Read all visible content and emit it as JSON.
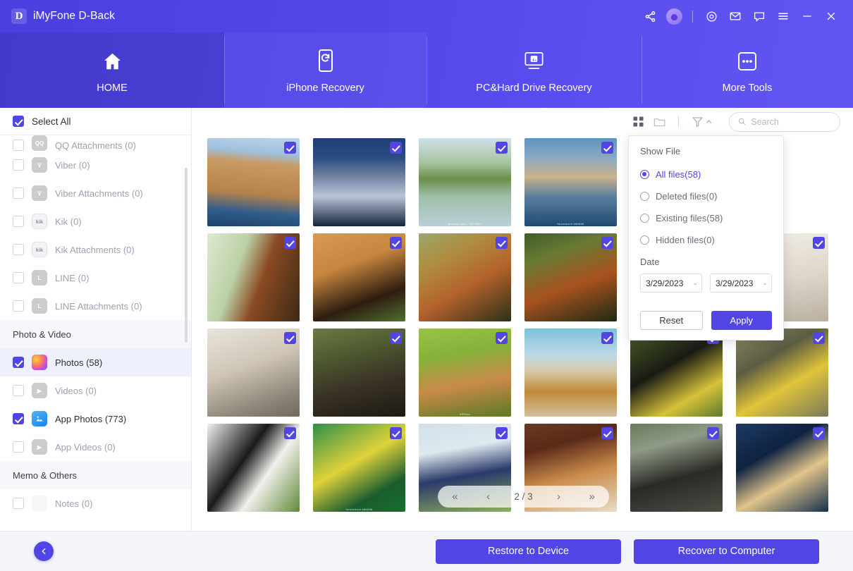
{
  "window": {
    "logo_letter": "D",
    "app_title": "iMyFone D-Back",
    "titlebar_icons": [
      {
        "name": "share-icon"
      },
      {
        "name": "account-avatar-icon"
      },
      {
        "name": "target-icon"
      },
      {
        "name": "mail-icon"
      },
      {
        "name": "chat-icon"
      },
      {
        "name": "menu-icon"
      },
      {
        "name": "minimize-icon"
      },
      {
        "name": "close-icon"
      }
    ]
  },
  "nav": {
    "tabs": [
      {
        "id": "home",
        "label": "HOME",
        "icon": "house-icon",
        "active": true
      },
      {
        "id": "iphone",
        "label": "iPhone Recovery",
        "icon": "phone-refresh-icon",
        "active": false
      },
      {
        "id": "pc",
        "label": "PC&Hard Drive Recovery",
        "icon": "monitor-key-icon",
        "active": false
      },
      {
        "id": "more",
        "label": "More Tools",
        "icon": "ellipsis-box-icon",
        "active": false
      }
    ]
  },
  "sidebar": {
    "select_all_label": "Select All",
    "select_all_checked": true,
    "items": [
      {
        "label": "QQ Attachments (0)",
        "icon": "qq-icon",
        "checked": false,
        "enabled": false,
        "clipped": true
      },
      {
        "label": "Viber (0)",
        "icon": "viber-icon",
        "checked": false,
        "enabled": false
      },
      {
        "label": "Viber Attachments (0)",
        "icon": "viber-icon",
        "checked": false,
        "enabled": false
      },
      {
        "label": "Kik (0)",
        "icon": "kik-icon",
        "checked": false,
        "enabled": false
      },
      {
        "label": "Kik Attachments (0)",
        "icon": "kik-icon",
        "checked": false,
        "enabled": false
      },
      {
        "label": "LINE (0)",
        "icon": "line-icon",
        "checked": false,
        "enabled": false
      },
      {
        "label": "LINE Attachments (0)",
        "icon": "line-icon",
        "checked": false,
        "enabled": false
      }
    ],
    "section_photo_video": "Photo & Video",
    "media_items": [
      {
        "label": "Photos (58)",
        "icon": "photos-icon",
        "checked": true,
        "enabled": true,
        "active": true
      },
      {
        "label": "Videos (0)",
        "icon": "videos-icon",
        "checked": false,
        "enabled": false
      },
      {
        "label": "App Photos (773)",
        "icon": "app-photos-icon",
        "checked": true,
        "enabled": true
      },
      {
        "label": "App Videos (0)",
        "icon": "app-videos-icon",
        "checked": false,
        "enabled": false
      }
    ],
    "section_memo_others": "Memo & Others",
    "other_items": [
      {
        "label": "Notes (0)",
        "icon": "notes-icon",
        "checked": false,
        "enabled": false
      }
    ]
  },
  "toolbar": {
    "grid_view_icon": "grid-view-icon",
    "folder_view_icon": "folder-view-icon",
    "filter_icon": "filter-icon",
    "filter_caret": "chevron-up-icon",
    "search_icon": "search-icon",
    "search_value": "",
    "search_placeholder": "Search"
  },
  "filter_panel": {
    "title": "Show File",
    "options": [
      {
        "label": "All files(58)",
        "selected": true
      },
      {
        "label": "Deleted files(0)",
        "selected": false
      },
      {
        "label": "Existing files(58)",
        "selected": false
      },
      {
        "label": "Hidden files(0)",
        "selected": false
      }
    ],
    "date_label": "Date",
    "date_from": "3/29/2023",
    "date_to": "3/29/2023",
    "reset_label": "Reset",
    "apply_label": "Apply",
    "accent": "#5145e5"
  },
  "pager": {
    "first_label": "«",
    "prev_label": "‹",
    "page_text": "2 / 3",
    "next_label": "›",
    "last_label": "»"
  },
  "footer": {
    "back_icon": "arrow-left-icon",
    "restore_label": "Restore to Device",
    "recover_label": "Recover to Computer"
  },
  "grid": {
    "columns": 6,
    "rows": 4,
    "items": [
      {
        "alt": "coastal-village-canal",
        "checked": true,
        "caption": "",
        "c1": "#8fb4d6",
        "c2": "#c99a63",
        "c3": "#2f5d8c",
        "style": "village"
      },
      {
        "alt": "mountain-town-at-dusk",
        "checked": true,
        "caption": "",
        "c1": "#2a4c82",
        "c2": "#b9c4d8",
        "c3": "#16233e",
        "style": "town"
      },
      {
        "alt": "tree-by-river",
        "checked": true,
        "caption": "pixabay.com - 3571803",
        "c1": "#b9cfd8",
        "c2": "#6a8f4a",
        "c3": "#d9e2e4",
        "style": "tree"
      },
      {
        "alt": "lakeside-houses",
        "checked": true,
        "caption": "fotosearch  k86666",
        "c1": "#4f86b8",
        "c2": "#c9b28a",
        "c3": "#1e4a72",
        "style": "lake"
      },
      {
        "alt": "sunrise-over-field",
        "checked": true,
        "caption": "",
        "c1": "#f0a33a",
        "c2": "#7fa23c",
        "c3": "#d97a2a",
        "style": "sunrise"
      },
      {
        "alt": "blank-white-tile",
        "checked": false,
        "caption": "",
        "c1": "#ffffff",
        "c2": "#ffffff",
        "c3": "#ffffff",
        "style": "blank"
      },
      {
        "alt": "red-panda-on-tree",
        "checked": true,
        "caption": "",
        "c1": "#dfe8d2",
        "c2": "#8a4a22",
        "c3": "#3c2a16",
        "style": "panda-tree"
      },
      {
        "alt": "red-panda-eating-bamboo",
        "checked": true,
        "caption": "",
        "c1": "#c7863f",
        "c2": "#4f7030",
        "c3": "#2e1d10",
        "style": "panda-eat"
      },
      {
        "alt": "red-panda-standing",
        "checked": true,
        "caption": "",
        "c1": "#9aa86a",
        "c2": "#b4622c",
        "c3": "#2b3018",
        "style": "panda-stand"
      },
      {
        "alt": "red-panda-on-logs",
        "checked": true,
        "caption": "",
        "c1": "#3f5c28",
        "c2": "#a8521f",
        "c3": "#1d2a12",
        "style": "panda-log"
      },
      {
        "alt": "blank-white-tile-2",
        "checked": false,
        "caption": "",
        "c1": "#ffffff",
        "c2": "#ffffff",
        "c3": "#ffffff",
        "style": "blank"
      },
      {
        "alt": "white-puppy",
        "checked": true,
        "caption": "",
        "c1": "#f2efe9",
        "c2": "#ded6c8",
        "c3": "#b9b0a2",
        "style": "puppy"
      },
      {
        "alt": "white-tiger-cubs",
        "checked": true,
        "caption": "",
        "c1": "#e8e4dc",
        "c2": "#8f8779",
        "c3": "#cfc6b6",
        "style": "tiger"
      },
      {
        "alt": "ibex-with-horns",
        "checked": true,
        "caption": "",
        "c1": "#6d7a44",
        "c2": "#3a3226",
        "c3": "#1c1a12",
        "style": "ibex"
      },
      {
        "alt": "caracal-snarling",
        "checked": true,
        "caption": "ARKive",
        "c1": "#86b23a",
        "c2": "#c98a4a",
        "c3": "#5a7a24",
        "style": "caracal"
      },
      {
        "alt": "shell-on-beach",
        "checked": true,
        "caption": "",
        "c1": "#7fc0dd",
        "c2": "#d9c9a8",
        "c3": "#c08a3a",
        "style": "shell"
      },
      {
        "alt": "elephant-in-yellow-flowers",
        "checked": true,
        "caption": "",
        "c1": "#4a6228",
        "c2": "#1a1a14",
        "c3": "#d6c23a",
        "style": "elephant-flowers"
      },
      {
        "alt": "yellow-boxfish",
        "checked": true,
        "caption": "",
        "c1": "#8a8a62",
        "c2": "#e0c43a",
        "c3": "#5c5c42",
        "style": "boxfish"
      },
      {
        "alt": "giant-panda-in-grass",
        "checked": true,
        "caption": "",
        "c1": "#f2f0ec",
        "c2": "#1a1a1a",
        "c3": "#5f8a3a",
        "style": "giant-panda"
      },
      {
        "alt": "green-tree-frog",
        "checked": true,
        "caption": "fotosearch  k86666",
        "c1": "#2f8f4a",
        "c2": "#e0d23a",
        "c3": "#1a5c2e",
        "style": "frog"
      },
      {
        "alt": "boat-on-water",
        "checked": true,
        "caption": "",
        "c1": "#cfe0ea",
        "c2": "#2a3a6a",
        "c3": "#8fb05a",
        "style": "boat"
      },
      {
        "alt": "dog-in-doorway",
        "checked": true,
        "caption": "",
        "c1": "#c98a4a",
        "c2": "#5a2a18",
        "c3": "#e8dcc8",
        "style": "dog"
      },
      {
        "alt": "elephants-bathing",
        "checked": true,
        "caption": "",
        "c1": "#6a7a5a",
        "c2": "#2a2a26",
        "c3": "#8f9a86",
        "style": "elephants"
      },
      {
        "alt": "two-meerkats",
        "checked": true,
        "caption": "",
        "c1": "#1e3a62",
        "c2": "#e0c48a",
        "c3": "#0e2240",
        "style": "meerkats"
      }
    ]
  }
}
